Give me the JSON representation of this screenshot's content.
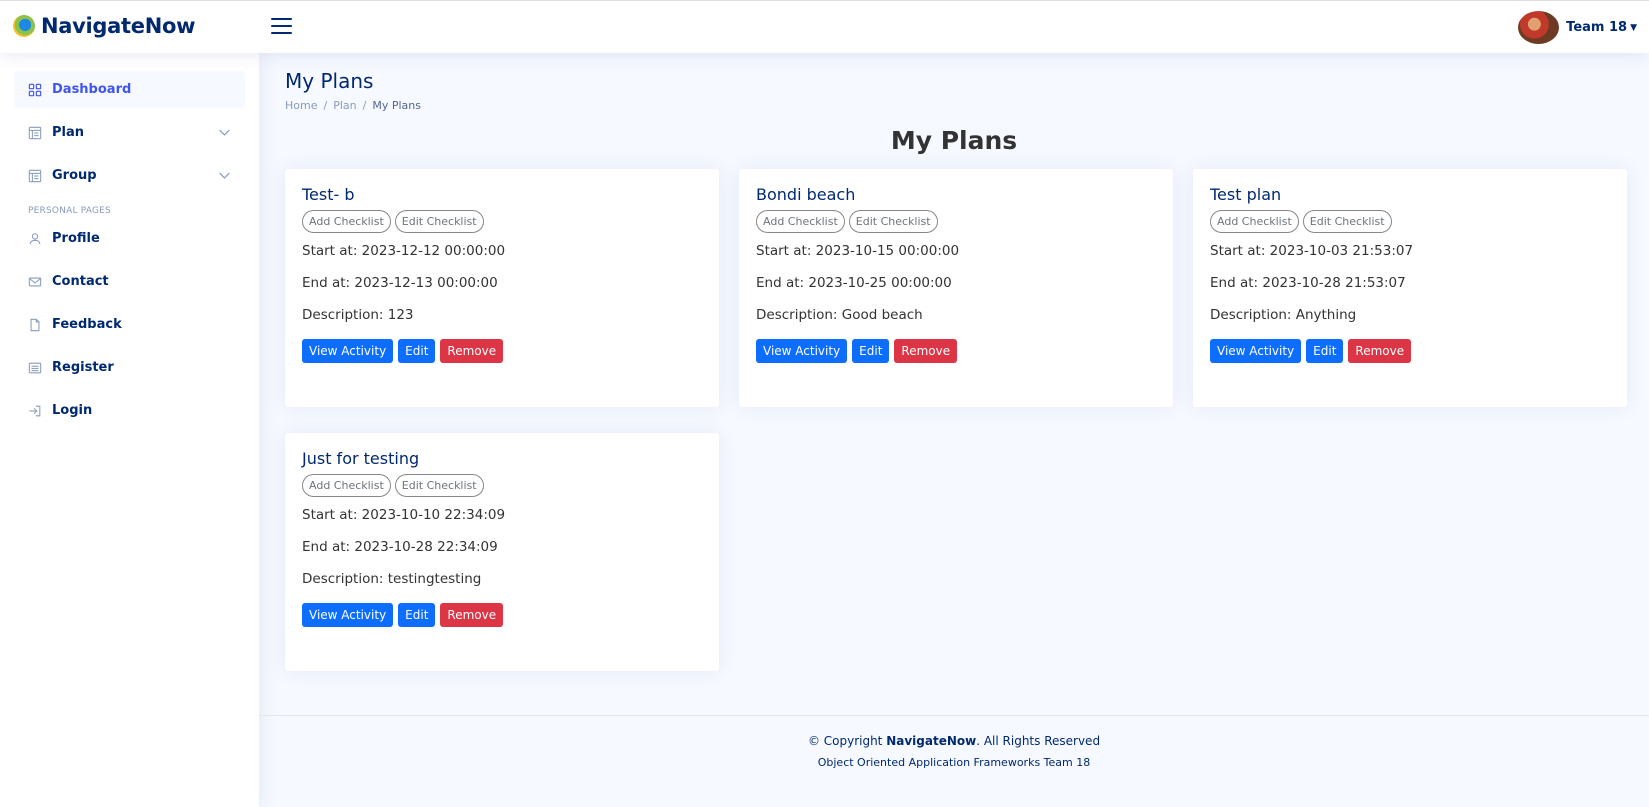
{
  "header": {
    "brand": "NavigateNow",
    "profile_name": "Team 18"
  },
  "sidebar": {
    "items": [
      {
        "label": "Dashboard"
      },
      {
        "label": "Plan"
      },
      {
        "label": "Group"
      }
    ],
    "heading": "PERSONAL PAGES",
    "pages": [
      {
        "label": "Profile"
      },
      {
        "label": "Contact"
      },
      {
        "label": "Feedback"
      },
      {
        "label": "Register"
      },
      {
        "label": "Login"
      }
    ]
  },
  "page": {
    "title": "My Plans",
    "breadcrumb": [
      "Home",
      "Plan",
      "My Plans"
    ],
    "section_title": "My Plans"
  },
  "card_labels": {
    "add_checklist": "Add Checklist",
    "edit_checklist": "Edit Checklist",
    "view_activity": "View Activity",
    "edit": "Edit",
    "remove": "Remove"
  },
  "plans": [
    {
      "title": "Test- b",
      "start": "Start at: 2023-12-12 00:00:00",
      "end": "End at: 2023-12-13 00:00:00",
      "description": "Description: 123"
    },
    {
      "title": "Bondi beach",
      "start": "Start at: 2023-10-15 00:00:00",
      "end": "End at: 2023-10-25 00:00:00",
      "description": "Description: Good beach"
    },
    {
      "title": "Test plan",
      "start": "Start at: 2023-10-03 21:53:07",
      "end": "End at: 2023-10-28 21:53:07",
      "description": "Description: Anything"
    },
    {
      "title": "Just for testing",
      "start": "Start at: 2023-10-10 22:34:09",
      "end": "End at: 2023-10-28 22:34:09",
      "description": "Description: testingtesting"
    }
  ],
  "footer": {
    "copy_prefix": "© Copyright ",
    "copy_brand": "NavigateNow",
    "copy_suffix": ". All Rights Reserved",
    "credit": "Object Oriented Application Frameworks Team 18"
  },
  "colors": {
    "brand": "#012970",
    "accent": "#4154f1",
    "primary": "#0d6efd",
    "danger": "#dc3545"
  }
}
